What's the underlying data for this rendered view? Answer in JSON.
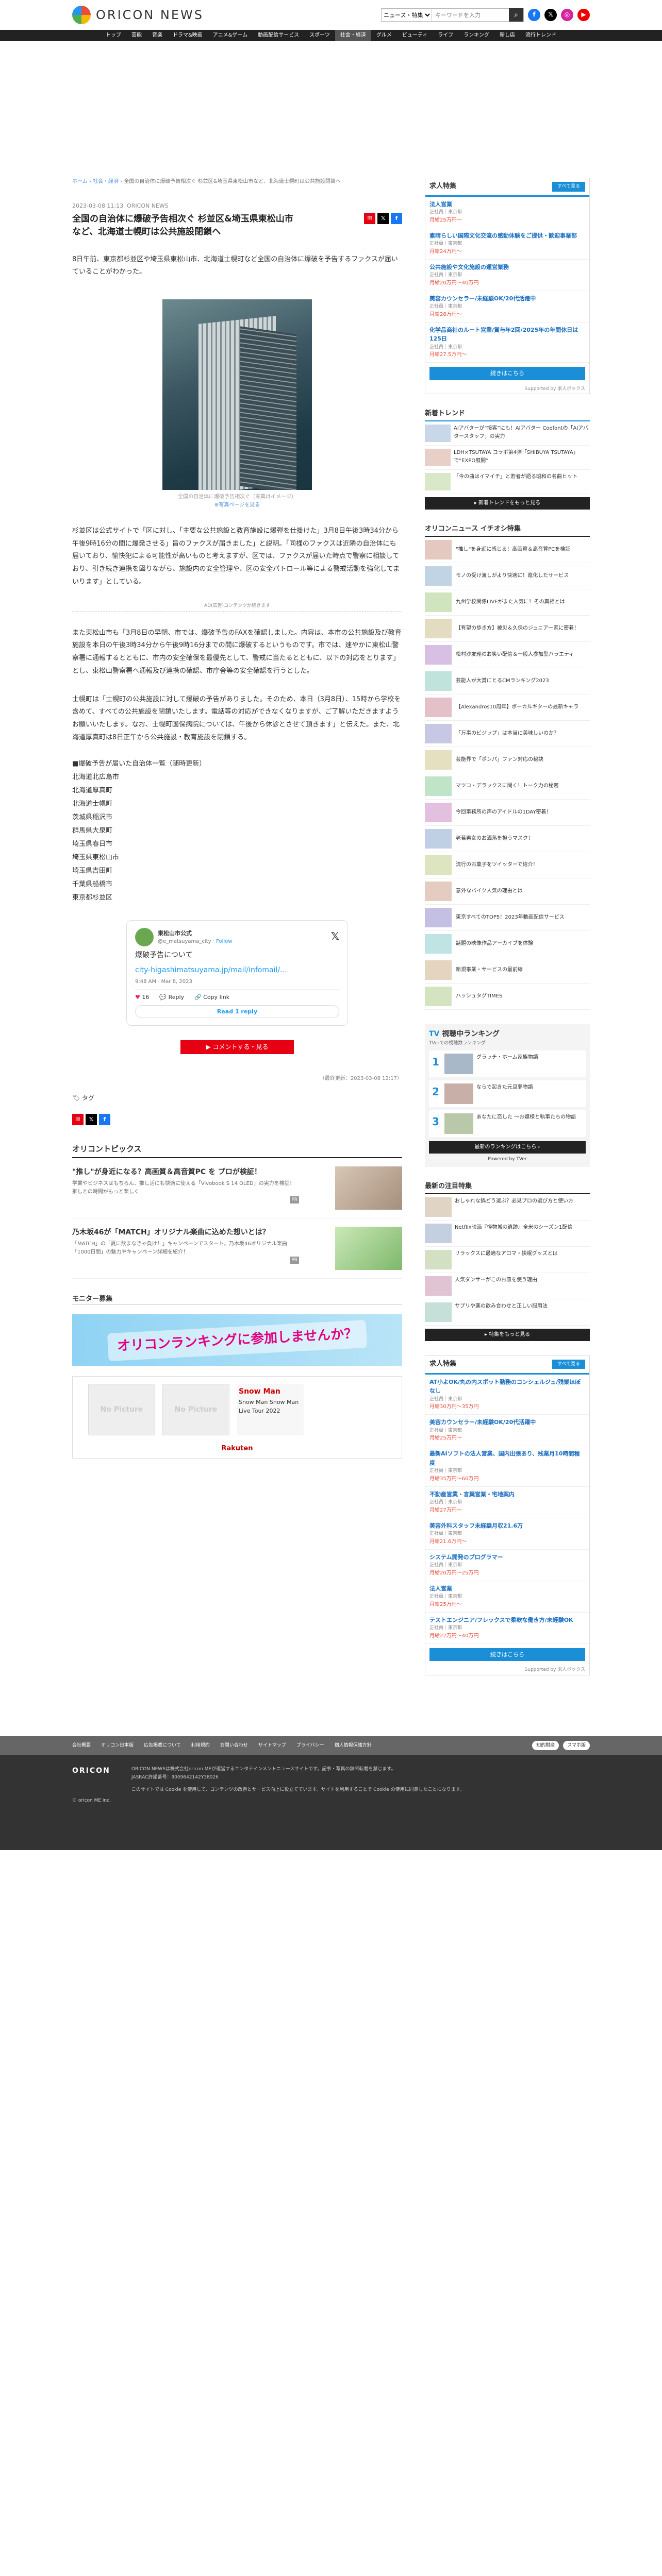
{
  "header": {
    "logo_text": "ORICON NEWS",
    "search_select": "ニュース・特集",
    "search_placeholder": "キーワードを入力"
  },
  "nav": [
    "トップ",
    "芸能",
    "音楽",
    "ドラマ&映画",
    "アニメ&ゲーム",
    "動画配信サービス",
    "スポーツ",
    "社会・経済",
    "グルメ",
    "ビューティ",
    "ライフ",
    "ランキング",
    "新し店",
    "流行トレンド"
  ],
  "nav_active": "社会・経済",
  "breadcrumb": [
    "ホーム",
    "社会・経済",
    "全国の自治体に爆破予告相次ぐ 杉並区&埼玉県東松山市など、北海道士幌町は公共施設閉鎖へ"
  ],
  "article": {
    "date": "2023-03-08 11:13",
    "source": "ORICON NEWS",
    "title": "全国の自治体に爆破予告相次ぐ 杉並区&埼玉県東松山市など、北海道士幌町は公共施設閉鎖へ",
    "lead": "8日午前、東京都杉並区や埼玉県東松山市、北海道士幌町など全国の自治体に爆破を予告するファクスが届いていることがわかった。",
    "photo_caption": "全国の自治体に爆破予告相次ぐ（写真はイメージ）",
    "photo_link": "⊕写真ページを見る",
    "para1": "杉並区は公式サイトで「区に対し、「主要な公共施設と教育施設に爆弾を仕掛けた」3月8日午後3時34分から午後9時16分の間に爆発させる」旨のファクスが届きました」と説明。「同様のファクスは近隣の自治体にも届いており、愉快犯による可能性が高いものと考えますが、区では、ファクスが届いた時点で警察に相談しており、引き続き連携を図りながら、施設内の安全管理や、区の安全パトロール等による警戒活動を強化してまいります」としている。",
    "ad_label": "AD(広告)コンテンツが続きます",
    "para2": "また東松山市も「3月8日の早朝、市では、爆破予告のFAXを確認しました。内容は、本市の公共施設及び教育施設を本日の午後3時34分から午後9時16分までの間に爆破するというものです。市では、速やかに東松山警察署に通報するとともに、市内の安全確保を最優先として、警戒に当たるとともに、以下の対応をとります」とし、東松山警察署へ通報及び連携の確認、市庁舎等の安全確認を行うとした。",
    "para3": "士幌町は「士幌町の公共施設に対して爆破の予告がありました。そのため、本日（3月8日）、15時から学校を含めて、すべての公共施設を閉鎖いたします。電話等の対応ができなくなりますが、ご了解いただきますようお願いいたします。なお、士幌町国保病院については、午後から休診とさせて頂きます」と伝えた。また、北海道厚真町は8日正午から公共施設・教育施設を閉鎖する。",
    "list_title": "■爆破予告が届いた自治体一覧（随時更新）",
    "list": [
      "北海道北広島市",
      "北海道厚真町",
      "北海道士幌町",
      "茨城県稲沢市",
      "群馬県大泉町",
      "埼玉県春日市",
      "埼玉県東松山市",
      "埼玉県吉田町",
      "千葉県船橋市",
      "東京都杉並区"
    ],
    "updated": "（最終更新：2023-03-08 12:17）",
    "tag_label": "タグ",
    "comment_btn": "▶ コメントする・見る"
  },
  "tweet": {
    "name": "東松山市公式",
    "handle": "@e_matsuyama_city",
    "follow": "Follow",
    "title": "爆破予告について",
    "link": "city-higashimatsuyama.jp/mail/infomail/…",
    "time": "9:48 AM · Mar 8, 2023",
    "likes": "16",
    "reply": "Reply",
    "copy": "Copy link",
    "read_reply": "Read 1 reply"
  },
  "topics": {
    "title": "オリコントピックス",
    "items": [
      {
        "title": "\"推し\"が身近になる？高画質＆高音質PC を プロが検証！",
        "desc": "学業やビジネスはもちろん、推し活にも快適に使える「Vivobook S 14 OLED」の実力を検証！推しとの時間がもっと楽しく",
        "pr": "PR"
      },
      {
        "title": "乃木坂46が「MATCH」オリジナル楽曲に込めた想いとは？",
        "desc": "「MATCH」の「夏に飲まなきゃ負け！」キャンペーンでスタート。乃木坂46オリジナル楽曲「1000日間」の魅力やキャンペーン詳細を紹介！",
        "pr": "PR"
      }
    ]
  },
  "monitor": {
    "title": "モニター募集",
    "banner": "オリコンランキングに参加しませんか？",
    "nopic1": "No Picture",
    "nopic2": "No Picture",
    "snowman_title": "Snow Man",
    "snowman_desc": "Snow Man Snow Man Live Tour 2022",
    "rakuten": "Rakuten"
  },
  "side": {
    "jobs_title": "求人特集",
    "jobs_badge": "すべて見る",
    "jobs": [
      {
        "t": "法人営業",
        "c": "正社員｜東京都",
        "s": "月給25万円〜"
      },
      {
        "t": "素晴らしい国際文化交流の感動体験をご提供・歓迎事業部",
        "c": "正社員｜東京都",
        "s": "月給24万円〜"
      },
      {
        "t": "公共施設や文化施設の運営業務",
        "c": "正社員｜東京都",
        "s": "月給20万円〜40万円"
      },
      {
        "t": "美容カウンセラー/未経験OK/20代活躍中",
        "c": "正社員｜東京都",
        "s": "月給28万円〜"
      },
      {
        "t": "化学品商社のルート営業/賞与年2回/2025年の年間休日は125日",
        "c": "正社員｜東京都",
        "s": "月給27.5万円〜"
      }
    ],
    "jobs_more": "続きはこちら",
    "jobs_foot": "Supported by 求人ボックス",
    "trend_title": "新着トレンド",
    "trends": [
      "AIアバターが“接客”にも！AIアバター Coefontの「AIアバタースタッフ」の実力",
      "LDH×TSUTAYA コラボ第4弾「SHIBUYA TSUTAYA」で“EXPO展開”",
      "「今の曲はイマイチ」と若者が語る昭和の名曲ヒット"
    ],
    "trend_more": "▸ 新着トレンドをもっと見る",
    "feat_title": "オリコンニュース イチオシ特集",
    "feats": [
      "\"推し\"を身近に感じる！高画質＆高音質PCを検証",
      "モノの受け渡しがより快適に！進化したサービス",
      "九州学校関係LIVEがまた人気に！その真相とは",
      "【有望の歩き方】被災＆久保のジュニア一家に密着！",
      "松村沙友理のお笑い配信＆一般人参加型バラエティ",
      "芸能人が大賞にとるCMランキング2023",
      "【Alexandros10周年】ボーカルギターの最新キャラ",
      "「万事のビジップ」は本当に美味しいのか？",
      "芸能界で「ポンパ」ファン対応の秘訣",
      "マツコ・デラックスに聞く！トーク力の秘密",
      "今回事務所の声のアイドルの1DAY密着！",
      "老若男女のお洒落を担うマスク！",
      "流行のお菓子をツイッターで紹介！",
      "意外なバイク人気の理由とは",
      "東京すべてのTOP5！2023年動画配信サービス",
      "話題の映像作品アーカイブを体験",
      "新規事業・サービスの最前線",
      "ハッシュタグTIMES"
    ],
    "tv_title": "視聴中ランキング",
    "tv_sub": "TVerでの視聴数ランキング",
    "tv": [
      {
        "rank": "1",
        "t": "グラッチ・ホーム家族物語"
      },
      {
        "rank": "2",
        "t": "ならで起きた元旦夢物語"
      },
      {
        "rank": "3",
        "t": "あなたに恋した ～お嬢様と執事たちの物語"
      }
    ],
    "tv_more": "最新のランキングはこちら ›",
    "tv_powered": "Powered by TVer",
    "notice_title": "最新の注目特集",
    "notices": [
      "おしゃれな鍋どう選ぶ？必見プロの選び方と使い方",
      "Netflix映画『怪物城の遺跡』全米のシーズン1配信",
      "リラックスに最適なアロマ・快眠グッズとは",
      "人気ダンサーがこのお皿を使う理由",
      "サプリや薬の飲み合わせと正しい服用法"
    ],
    "notice_more": "▸ 特集をもっと見る",
    "jobs2_title": "求人特集",
    "jobs2_badge": "すべて見る",
    "jobs2": [
      {
        "t": "AT小よOK/丸の内スポット勤務のコンシェルジュ/残業ほぼなし",
        "c": "正社員｜東京都",
        "s": "月給30万円〜35万円"
      },
      {
        "t": "美容カウンセラー/未経験OK/20代活躍中",
        "c": "正社員｜東京都",
        "s": "月給25万円〜"
      },
      {
        "t": "最新AIソフトの法人営業、国内出張あり、残業月10時間程度",
        "c": "正社員｜東京都",
        "s": "月給35万円〜60万円"
      },
      {
        "t": "不動産営業・言葉営業・宅地案内",
        "c": "正社員｜東京都",
        "s": "月給27万円〜"
      },
      {
        "t": "美容外科スタッフ未経験月収21.6万",
        "c": "正社員｜東京都",
        "s": "月給21.6万円〜"
      },
      {
        "t": "システム開発のプログラマー",
        "c": "正社員｜東京都",
        "s": "月給20万円〜25万円"
      },
      {
        "t": "法人営業",
        "c": "正社員｜東京都",
        "s": "月給25万円〜"
      },
      {
        "t": "テストエンジニア/フレックスで柔軟な働き方/未経験OK",
        "c": "正社員｜東京都",
        "s": "月給22万円〜40万円"
      }
    ],
    "jobs2_more": "続きはこちら",
    "jobs2_foot": "Supported by 求人ボックス"
  },
  "footer": {
    "links": [
      "会社概要",
      "オリコン日本版",
      "広告掲載について",
      "利用規約",
      "お問い合わせ",
      "サイトマップ",
      "プライバシー",
      "個人情報保護方針"
    ],
    "btn1": "知的財産",
    "btn2": "スマホ版",
    "logo": "ORICON",
    "copyright": "© oricon ME inc.",
    "text1": "ORICON NEWSは株式会社oricon MEが運営するエンタテインメントニュースサイトです。記事・写真の無断転載を禁じます。",
    "text2": "JASRAC許諾番号：9009642142Y38026",
    "text3": "このサイトでは Cookie を使用して、コンテンツの改善とサービス向上に役立てています。サイトを利用することで Cookie の使用に同意したことになります。"
  },
  "colors": {
    "accent": "#1a8fd8",
    "red": "#e60012",
    "dark": "#222222"
  }
}
